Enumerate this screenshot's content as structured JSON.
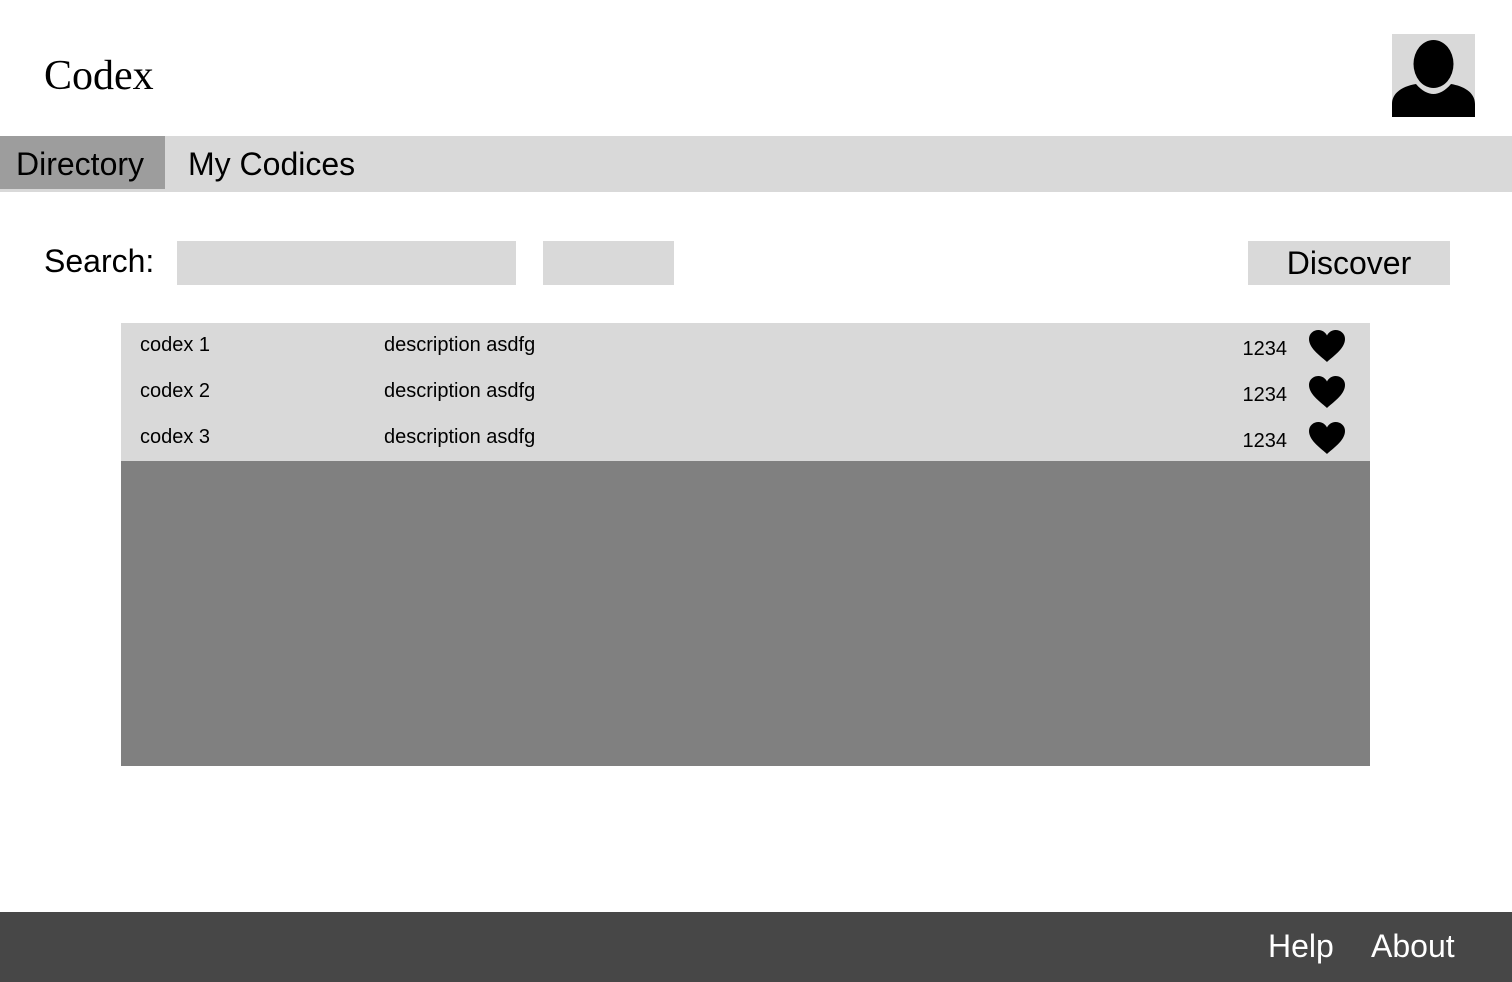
{
  "header": {
    "title": "Codex",
    "avatar_icon": "user-avatar-icon"
  },
  "nav": {
    "tabs": [
      {
        "label": "Directory",
        "active": true
      },
      {
        "label": "My Codices",
        "active": false
      }
    ]
  },
  "search": {
    "label": "Search:",
    "value": "",
    "placeholder": "",
    "submit_label": "",
    "discover_label": "Discover"
  },
  "codices": [
    {
      "name": "codex 1",
      "description": "description asdfg",
      "count": "1234",
      "icon": "heart-icon"
    },
    {
      "name": "codex 2",
      "description": "description asdfg",
      "count": "1234",
      "icon": "heart-icon"
    },
    {
      "name": "codex 3",
      "description": "description asdfg",
      "count": "1234",
      "icon": "heart-icon"
    }
  ],
  "footer": {
    "help_label": "Help",
    "about_label": "About"
  },
  "colors": {
    "panel_light": "#d9d9d9",
    "tab_active": "#9d9d9d",
    "list_background": "#808080",
    "footer_background": "#474747"
  }
}
